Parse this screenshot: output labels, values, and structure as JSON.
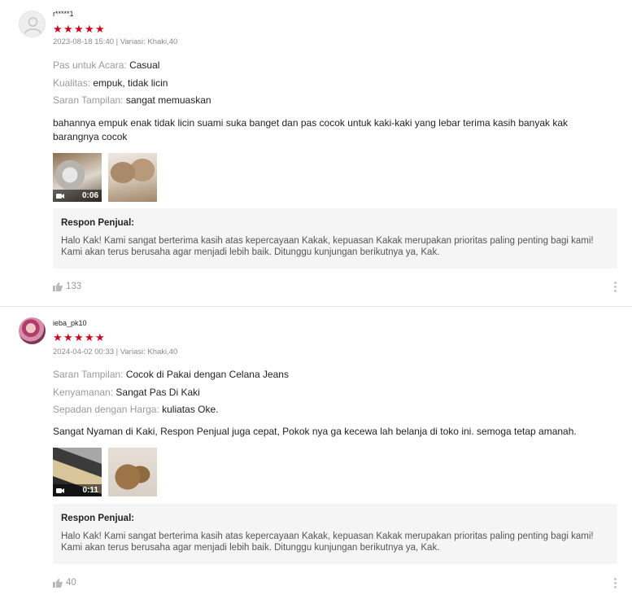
{
  "reviews": [
    {
      "username": "r*****1",
      "rating": 5,
      "meta": "2023-08-18 15:40 | Variasi: Khaki,40",
      "attributes": [
        {
          "key": "Pas untuk Acara:",
          "value": "Casual"
        },
        {
          "key": "Kualitas:",
          "value": "empuk, tidak licin"
        },
        {
          "key": "Saran Tampilan:",
          "value": "sangat memuaskan"
        }
      ],
      "comment": "bahannya empuk enak tidak licin suami suka banget dan pas cocok untuk kaki-kaki yang lebar terima kasih banyak kak barangnya cocok",
      "video_duration": "0:06",
      "reply_title": "Respon Penjual:",
      "reply_text": "Halo Kak! Kami sangat berterima kasih atas kepercayaan Kakak, kepuasan Kakak merupakan prioritas paling penting bagi kami! Kami akan terus berusaha agar menjadi lebih baik. Ditunggu kunjungan berikutnya ya, Kak.",
      "likes": "133"
    },
    {
      "username": "ieba_pk10",
      "rating": 5,
      "meta": "2024-04-02 00:33 | Variasi: Khaki,40",
      "attributes": [
        {
          "key": "Saran Tampilan:",
          "value": "Cocok di Pakai dengan Celana Jeans"
        },
        {
          "key": "Kenyamanan:",
          "value": "Sangat Pas Di Kaki"
        },
        {
          "key": "Sepadan dengan Harga:",
          "value": "kuliatas Oke."
        }
      ],
      "comment": "Sangat Nyaman di Kaki, Respon Penjual juga cepat, Pokok nya ga kecewa lah belanja di toko ini. semoga tetap amanah.",
      "video_duration": "0:11",
      "reply_title": "Respon Penjual:",
      "reply_text": "Halo Kak! Kami sangat berterima kasih atas kepercayaan Kakak, kepuasan Kakak merupakan prioritas paling penting bagi kami! Kami akan terus berusaha agar menjadi lebih baik. Ditunggu kunjungan berikutnya ya, Kak.",
      "likes": "40"
    }
  ],
  "icons": {
    "star": "star-icon",
    "camera": "video-camera-icon",
    "like": "thumbs-up-icon",
    "more": "more-vertical-icon"
  },
  "colors": {
    "star": "#d0011b",
    "reply_bg": "#f5f5f5",
    "muted": "#8a8a8a"
  }
}
